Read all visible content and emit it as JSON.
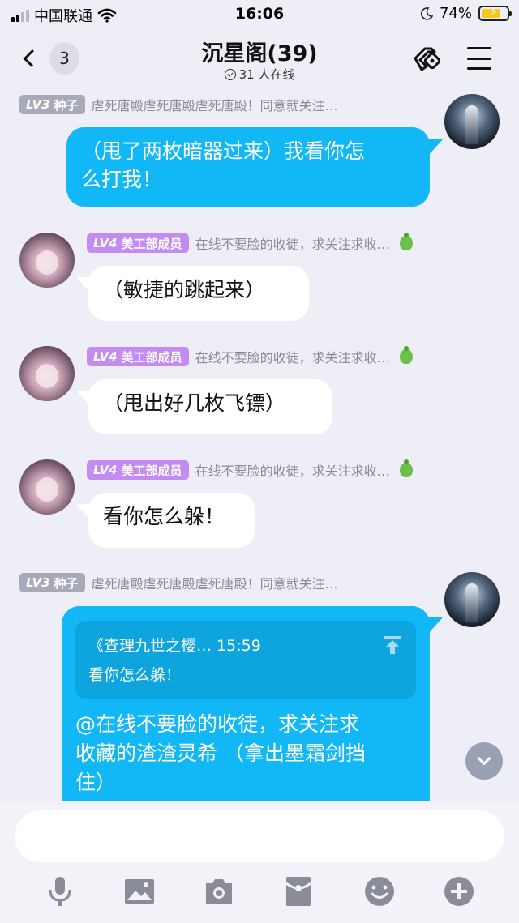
{
  "status_bar": {
    "carrier": "中国联通",
    "time": "16:06",
    "battery_percent": "74%",
    "icons": [
      "signal-icon",
      "wifi-icon",
      "moon-icon",
      "battery-charging-icon"
    ]
  },
  "header": {
    "unread_count": "3",
    "title": "沉星阁(39)",
    "online": "31 人在线"
  },
  "messages": [
    {
      "level": "LV3",
      "rank": "种子",
      "sender": "虐死唐殿虐死唐殿虐死唐殿！同意就关注…",
      "text": "（甩了两枚暗器过来）我看你怎么打我！",
      "lines": [
        "（甩了两枚暗器过来）我看你怎",
        "么打我！"
      ]
    },
    {
      "level": "LV4",
      "rank": "美工部成员",
      "sender": "在线不要脸的收徒，求关注求收…",
      "text": "（敏捷的跳起来）"
    },
    {
      "level": "LV4",
      "rank": "美工部成员",
      "sender": "在线不要脸的收徒，求关注求收…",
      "text": "（甩出好几枚飞镖）"
    },
    {
      "level": "LV4",
      "rank": "美工部成员",
      "sender": "在线不要脸的收徒，求关注求收…",
      "text": "看你怎么躲！"
    },
    {
      "level": "LV3",
      "rank": "种子",
      "sender": "虐死唐殿虐死唐殿虐死唐殿！同意就关注…",
      "quote": {
        "source": "《查理九世之樱… 15:59",
        "text": "看你怎么躲！"
      },
      "lines": [
        "@在线不要脸的收徒，求关注求",
        "收藏的渣渣灵希 （拿出墨霜剑挡",
        "住）"
      ]
    }
  ],
  "input": {
    "placeholder": ""
  },
  "toolbar": [
    "microphone-icon",
    "image-icon",
    "camera-icon",
    "red-packet-icon",
    "emoji-icon",
    "plus-icon"
  ],
  "colors": {
    "bubble_blue": "#12b7f5",
    "background": "#eeeef6",
    "level_gray": "#a8aab8",
    "level_purple": "#c48cf2"
  }
}
